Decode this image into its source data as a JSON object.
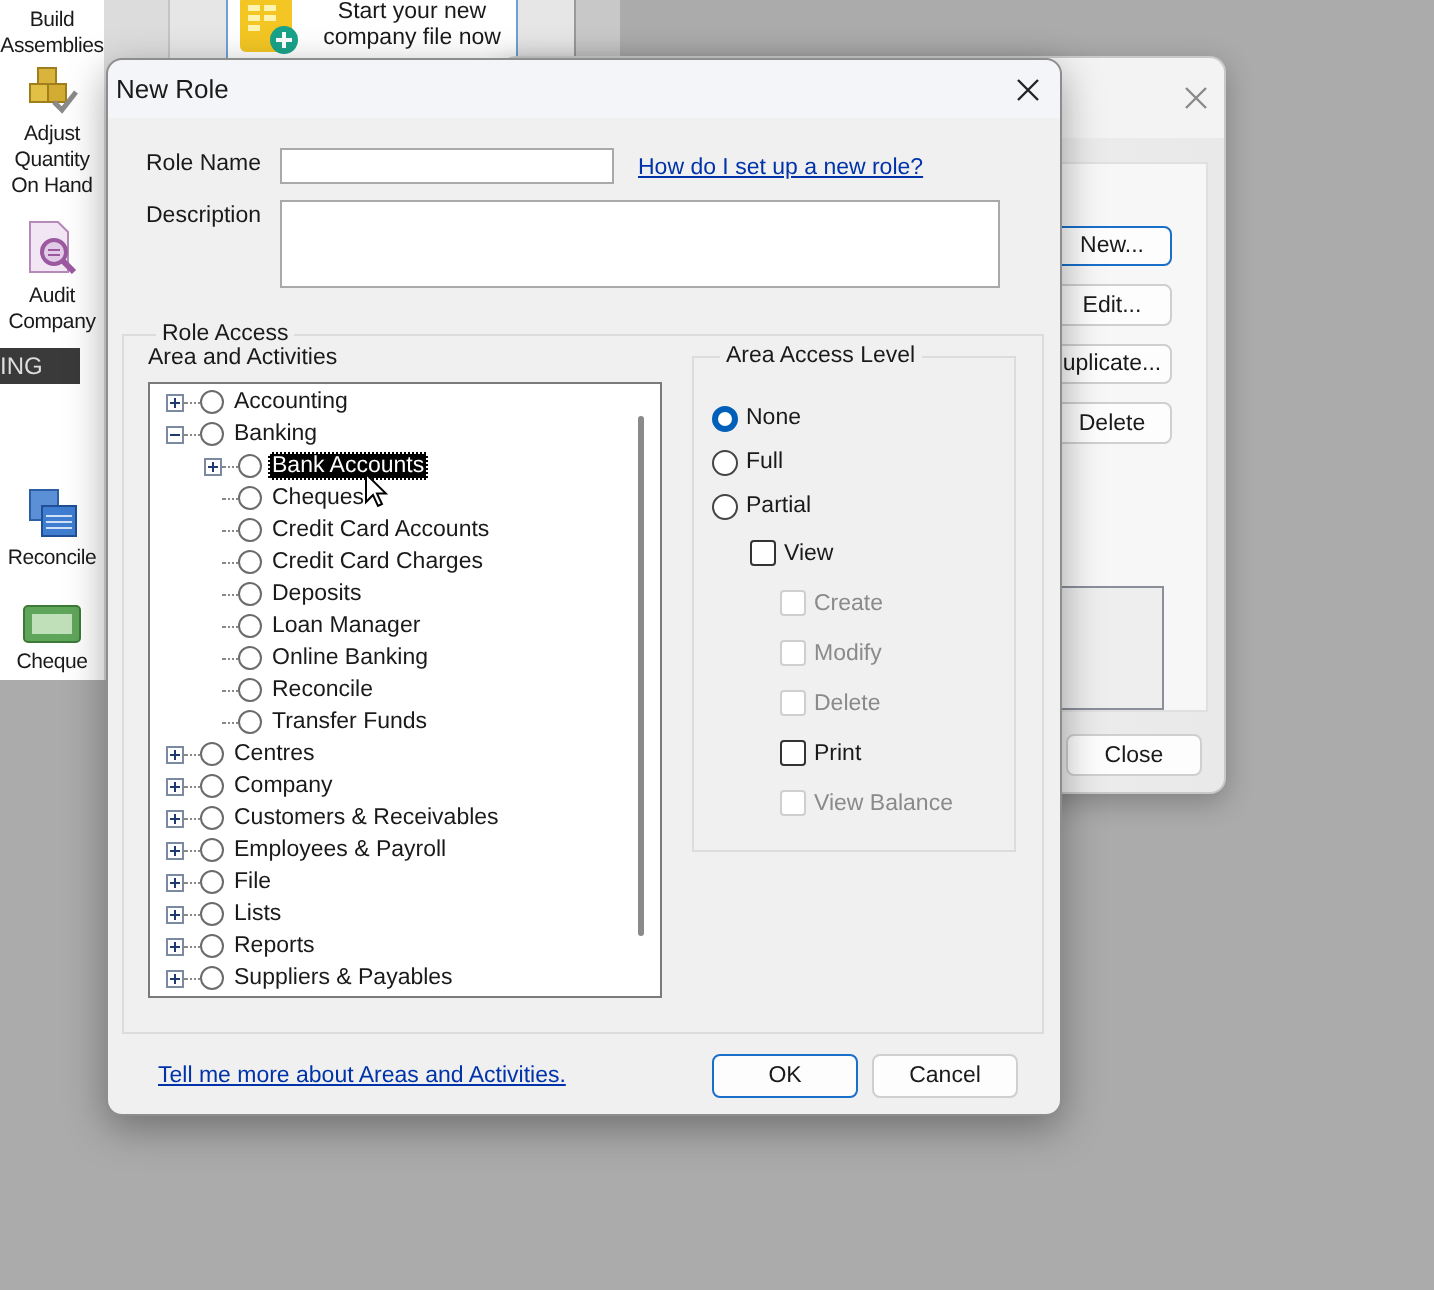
{
  "app_sidebar": {
    "items": [
      {
        "kind": "item",
        "label": "Build Assemblies"
      },
      {
        "kind": "item",
        "label": "Adjust Quantity On Hand"
      },
      {
        "kind": "item",
        "label": "Audit Company"
      },
      {
        "kind": "section",
        "label": "ING"
      },
      {
        "kind": "item",
        "label": "Reconcile"
      },
      {
        "kind": "item",
        "label": "Cheque"
      }
    ]
  },
  "home_card": {
    "text": "Start your new company file now"
  },
  "roles_window": {
    "buttons": [
      {
        "label": "New...",
        "default": true
      },
      {
        "label": "Edit...",
        "default": false
      },
      {
        "label": "uplicate...",
        "default": false
      },
      {
        "label": "Delete",
        "default": false
      }
    ],
    "close_button": "Close"
  },
  "dialog": {
    "title": "New Role",
    "role_name": {
      "label": "Role Name"
    },
    "help_link": "How do I set up a new role?",
    "description": {
      "label": "Description"
    },
    "role_access": {
      "title": "Role Access",
      "tree_label": "Area and Activities",
      "tree": [
        {
          "label": "Accounting",
          "kind": "branch",
          "expanded": false,
          "selected": false
        },
        {
          "label": "Banking",
          "kind": "branch",
          "expanded": true,
          "selected": false,
          "children": [
            {
              "label": "Bank Accounts",
              "kind": "branch",
              "expanded": false,
              "selected": true
            },
            {
              "label": "Cheques",
              "kind": "leaf",
              "expanded": false,
              "selected": false
            },
            {
              "label": "Credit Card Accounts",
              "kind": "leaf",
              "expanded": false,
              "selected": false
            },
            {
              "label": "Credit Card Charges",
              "kind": "leaf",
              "expanded": false,
              "selected": false
            },
            {
              "label": "Deposits",
              "kind": "leaf",
              "expanded": false,
              "selected": false
            },
            {
              "label": "Loan Manager",
              "kind": "leaf",
              "expanded": false,
              "selected": false
            },
            {
              "label": "Online Banking",
              "kind": "leaf",
              "expanded": false,
              "selected": false
            },
            {
              "label": "Reconcile",
              "kind": "leaf",
              "expanded": false,
              "selected": false
            },
            {
              "label": "Transfer Funds",
              "kind": "leaf",
              "expanded": false,
              "selected": false
            }
          ]
        },
        {
          "label": "Centres",
          "kind": "branch",
          "expanded": false,
          "selected": false
        },
        {
          "label": "Company",
          "kind": "branch",
          "expanded": false,
          "selected": false
        },
        {
          "label": "Customers & Receivables",
          "kind": "branch",
          "expanded": false,
          "selected": false
        },
        {
          "label": "Employees & Payroll",
          "kind": "branch",
          "expanded": false,
          "selected": false
        },
        {
          "label": "File",
          "kind": "branch",
          "expanded": false,
          "selected": false
        },
        {
          "label": "Lists",
          "kind": "branch",
          "expanded": false,
          "selected": false
        },
        {
          "label": "Reports",
          "kind": "branch",
          "expanded": false,
          "selected": false
        },
        {
          "label": "Suppliers & Payables",
          "kind": "branch",
          "expanded": false,
          "selected": false
        }
      ],
      "access_level": {
        "title": "Area Access Level",
        "options": [
          {
            "label": "None",
            "selected": true
          },
          {
            "label": "Full",
            "selected": false
          },
          {
            "label": "Partial",
            "selected": false
          }
        ],
        "permissions": [
          {
            "label": "View",
            "checked": false,
            "disabled": false,
            "nested": false
          },
          {
            "label": "Create",
            "checked": false,
            "disabled": true,
            "nested": true
          },
          {
            "label": "Modify",
            "checked": false,
            "disabled": true,
            "nested": true
          },
          {
            "label": "Delete",
            "checked": false,
            "disabled": true,
            "nested": true
          },
          {
            "label": "Print",
            "checked": false,
            "disabled": false,
            "nested": true
          },
          {
            "label": "View Balance",
            "checked": false,
            "disabled": true,
            "nested": true
          }
        ]
      }
    },
    "footer_link": "Tell me more about Areas and Activities.",
    "buttons": [
      {
        "label": "OK",
        "default": true
      },
      {
        "label": "Cancel",
        "default": false
      }
    ]
  }
}
